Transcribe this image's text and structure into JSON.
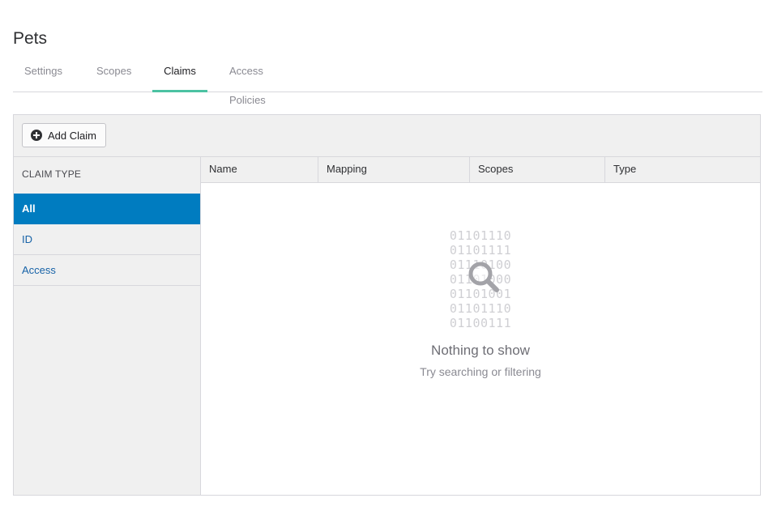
{
  "page": {
    "title": "Pets"
  },
  "tabs": [
    {
      "label": "Settings",
      "active": false
    },
    {
      "label": "Scopes",
      "active": false
    },
    {
      "label": "Claims",
      "active": true
    },
    {
      "label": "Access Policies",
      "active": false
    }
  ],
  "toolbar": {
    "add_label": "Add Claim",
    "add_icon": "plus-circle-icon"
  },
  "sidebar": {
    "header": "CLAIM TYPE",
    "items": [
      {
        "label": "All",
        "selected": true
      },
      {
        "label": "ID",
        "selected": false
      },
      {
        "label": "Access",
        "selected": false
      }
    ]
  },
  "table": {
    "columns": [
      "Name",
      "Mapping",
      "Scopes",
      "Type"
    ]
  },
  "empty_state": {
    "binary_lines": [
      "01101110",
      "01101111",
      "01110100",
      "01101000",
      "01101001",
      "01101110",
      "01100111"
    ],
    "icon": "magnifier-icon",
    "title": "Nothing to show",
    "subtitle": "Try searching or filtering"
  },
  "colors": {
    "accent_tab": "#4cc2a2",
    "selected_item": "#007cc0",
    "link": "#1662a7"
  }
}
